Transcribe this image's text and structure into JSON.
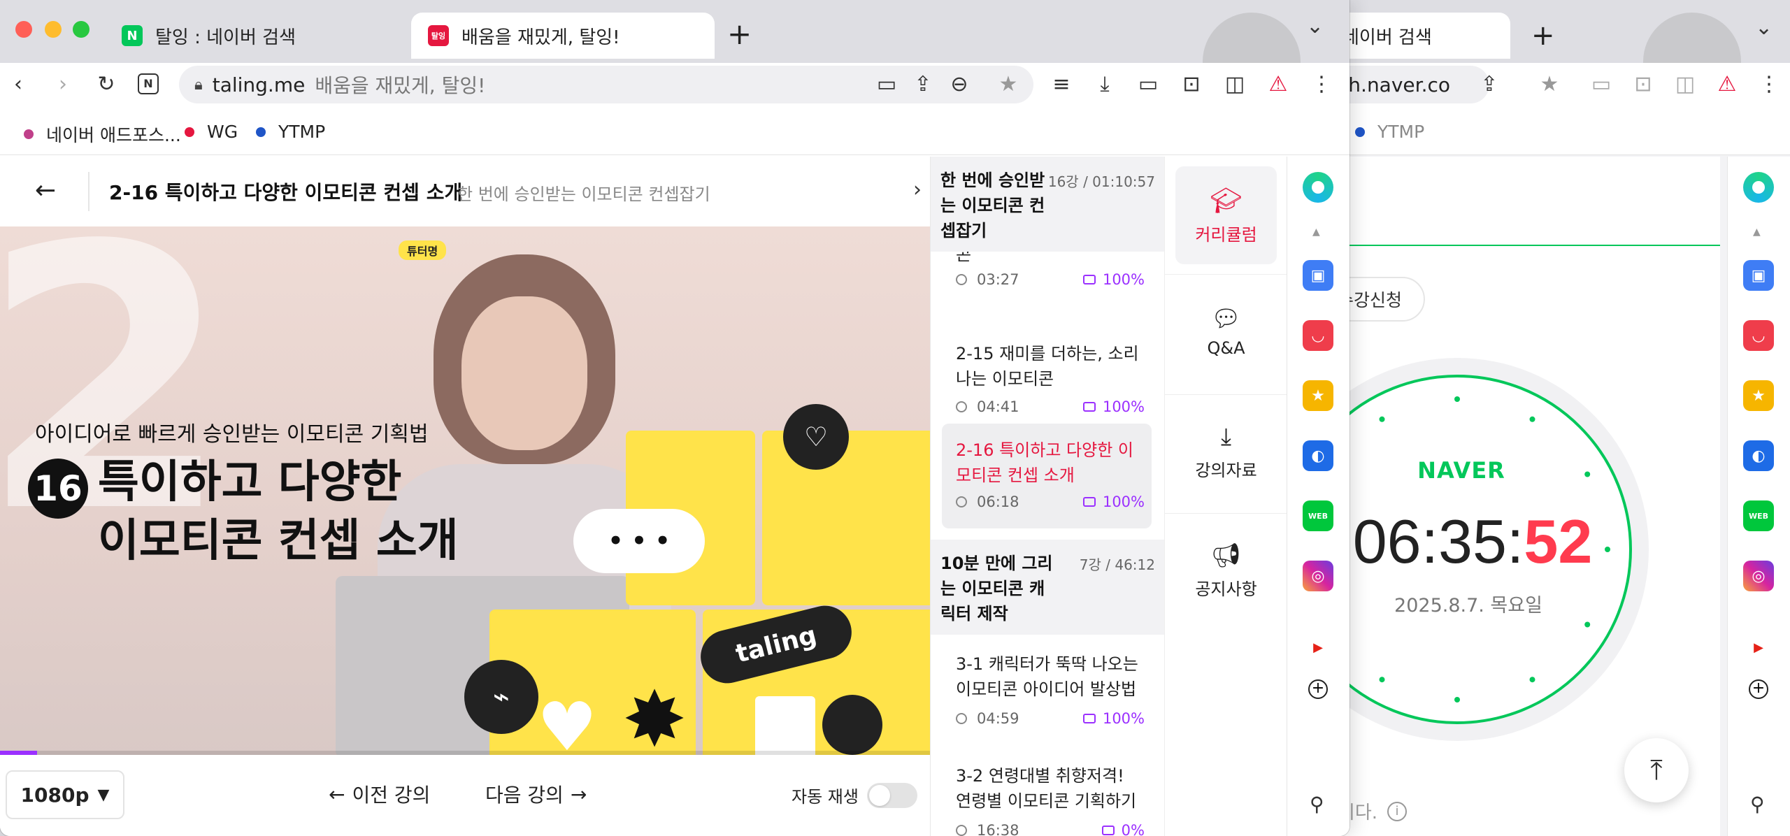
{
  "back_window": {
    "tab_title": "네이버 검색",
    "url_partial": "rch.naver.co",
    "bookmark": "YTMP",
    "enroll_button": "수강신청",
    "clock": {
      "brand": "NAVER",
      "hm": "06:35:",
      "sec": "52",
      "date": "2025.8.7. 목요일"
    },
    "footer_text": "습니다.",
    "colors": {
      "naver_green": "#03c75a",
      "seconds_red": "#ff3b4e"
    }
  },
  "browser": {
    "tabs": [
      {
        "title": "탈잉 : 네이버 검색",
        "favicon": "N",
        "favicon_color": "#03c75a"
      },
      {
        "title": "배움을 재밌게, 탈잉!",
        "favicon": "탈잉",
        "favicon_color": "#e5173f"
      }
    ],
    "new_tab_label": "+",
    "url_domain": "taling.me",
    "url_title": "배움을 재밌게, 탈잉!",
    "bookmarks": [
      {
        "label": "네이버 애드포스...",
        "color": "#c0408a"
      },
      {
        "label": "WG",
        "color": "#e5173f"
      },
      {
        "label": "YTMP",
        "color": "#1f55c7"
      }
    ]
  },
  "lecture": {
    "title": "2-16 특이하고 다양한 이모티콘 컨셉 소개",
    "course": "한 번에 승인받는 이모티콘 컨셉잡기",
    "video": {
      "tutor_badge": "튜터명",
      "subtitle": "아이디어로 빠르게 승인받는 이모티콘 기획법",
      "number": "16",
      "headline_1": "특이하고 다양한",
      "headline_2": "이모티콘 컨셉 소개",
      "big_digit": "2",
      "brand": "taling",
      "speech": "• • •",
      "progress": 0.04
    },
    "controls": {
      "quality": "1080p",
      "prev": "이전 강의",
      "next": "다음 강의",
      "autoplay": "자동 재생"
    }
  },
  "playlist": {
    "section1": {
      "title": "한 번에 승인받는 이모티콘 컨셉잡기",
      "meta": "16강 / 01:10:57"
    },
    "items1": [
      {
        "title": "콘",
        "time": "03:27",
        "pct": "100%"
      },
      {
        "title": "2-15 재미를 더하는, 소리나는 이모티콘",
        "time": "04:41",
        "pct": "100%"
      },
      {
        "title": "2-16 특이하고 다양한 이모티콘 컨셉 소개",
        "time": "06:18",
        "pct": "100%"
      }
    ],
    "section2": {
      "title": "10분 만에 그리는 이모티콘 캐릭터 제작",
      "meta": "7강 / 46:12"
    },
    "items2": [
      {
        "title": "3-1 캐릭터가 뚝딱 나오는 이모티콘 아이디어 발상법",
        "time": "04:59",
        "pct": "100%"
      },
      {
        "title": "3-2 연령대별 취향저격! 연령별 이모티콘 기획하기",
        "time": "16:38",
        "pct": "0%"
      }
    ]
  },
  "side_tabs": [
    "커리큘럼",
    "Q&A",
    "강의자료",
    "공지사항"
  ],
  "accent": "#e5173f"
}
